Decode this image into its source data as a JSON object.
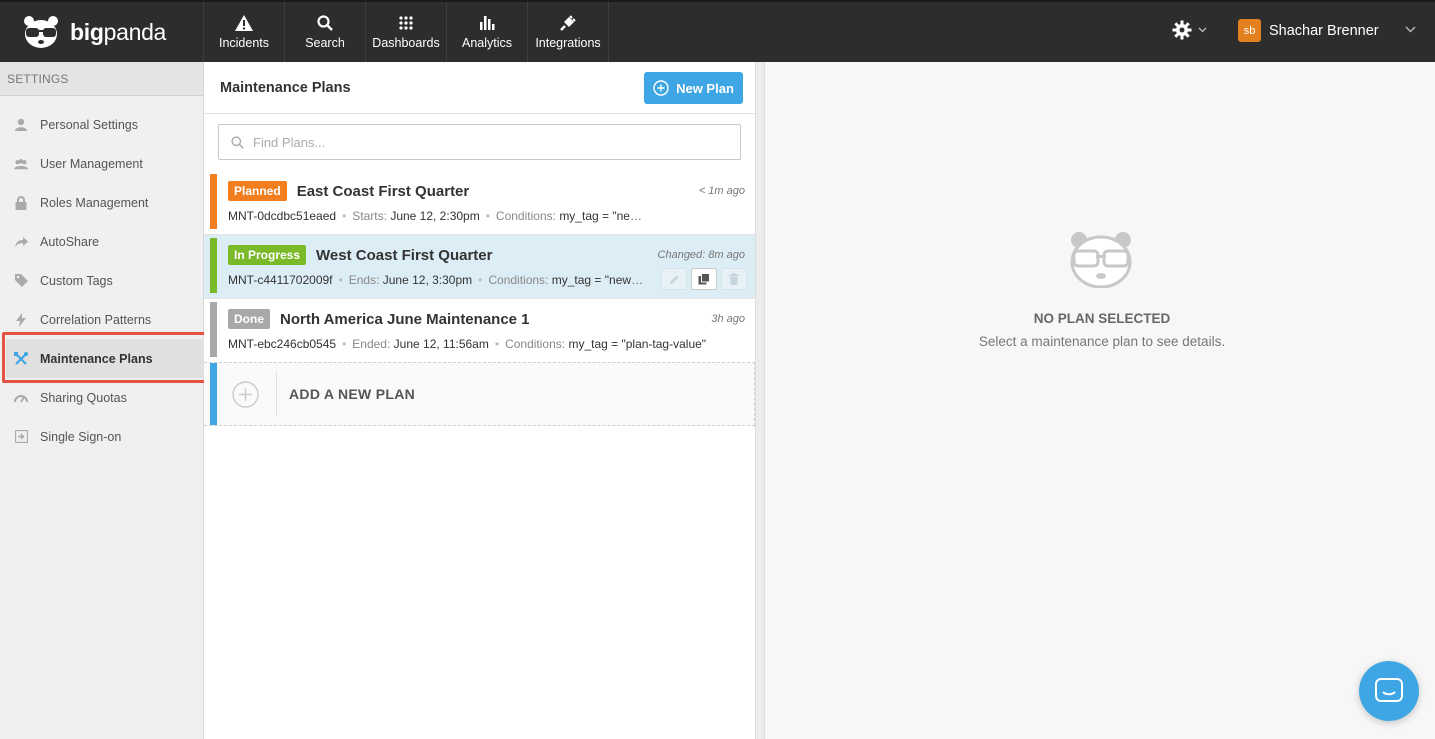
{
  "app": {
    "logo_bold": "big",
    "logo_rest": "panda",
    "brand_color": "#3fa6e6"
  },
  "nav": [
    {
      "label": "Incidents",
      "icon": "warning-icon"
    },
    {
      "label": "Search",
      "icon": "search-icon"
    },
    {
      "label": "Dashboards",
      "icon": "grid-icon"
    },
    {
      "label": "Analytics",
      "icon": "bar-chart-icon"
    },
    {
      "label": "Integrations",
      "icon": "plug-icon"
    }
  ],
  "user": {
    "initials": "sb",
    "name": "Shachar Brenner"
  },
  "sidebar": {
    "header": "SETTINGS",
    "items": [
      {
        "label": "Personal Settings",
        "icon": "person-icon"
      },
      {
        "label": "User Management",
        "icon": "users-icon"
      },
      {
        "label": "Roles Management",
        "icon": "lock-icon"
      },
      {
        "label": "AutoShare",
        "icon": "share-arrow-icon"
      },
      {
        "label": "Custom Tags",
        "icon": "tag-icon"
      },
      {
        "label": "Correlation Patterns",
        "icon": "lightning-icon"
      },
      {
        "label": "Maintenance Plans",
        "icon": "tools-icon",
        "active": true
      },
      {
        "label": "Sharing Quotas",
        "icon": "gauge-icon"
      },
      {
        "label": "Single Sign-on",
        "icon": "sign-in-icon"
      }
    ]
  },
  "plans_panel": {
    "title": "Maintenance Plans",
    "new_button": "New Plan",
    "search_placeholder": "Find Plans...",
    "plans": [
      {
        "status": "Planned",
        "status_color": "#f37e1f",
        "name": "East Coast First Quarter",
        "time": "< 1m ago",
        "id": "MNT-0dcdbc51eaed",
        "date_key": "Starts:",
        "date_val": "June 12, 2:30pm",
        "cond_key": "Conditions:",
        "cond_val": "my_tag = \"new_user\""
      },
      {
        "status": "In Progress",
        "status_color": "#7ab929",
        "name": "West Coast First Quarter",
        "time_key": "Changed:",
        "time": "8m ago",
        "id": "MNT-c4411702009f",
        "date_key": "Ends:",
        "date_val": "June 12, 3:30pm",
        "cond_key": "Conditions:",
        "cond_val": "my_tag = \"new_user\"",
        "selected": true
      },
      {
        "status": "Done",
        "status_color": "#a8a8a8",
        "name": "North America June Maintenance 1",
        "time": "3h ago",
        "id": "MNT-ebc246cb0545",
        "date_key": "Ended:",
        "date_val": "June 12, 11:56am",
        "cond_key": "Conditions:",
        "cond_val": "my_tag = \"plan-tag-value\""
      }
    ],
    "add_label": "ADD A NEW PLAN"
  },
  "detail": {
    "empty_title": "NO PLAN SELECTED",
    "empty_sub": "Select a maintenance plan to see details."
  }
}
